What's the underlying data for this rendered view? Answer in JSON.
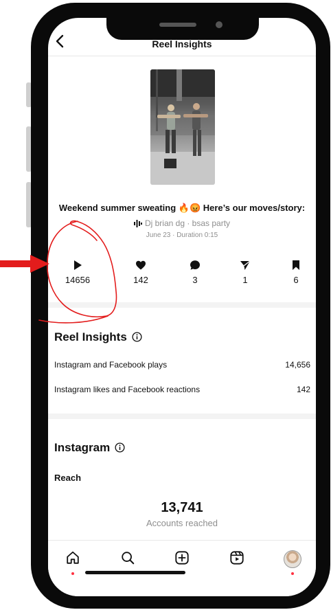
{
  "header": {
    "title": "Reel Insights"
  },
  "post": {
    "caption": "Weekend summer sweating 🔥😡 Here’s our moves/story:",
    "audio": "Dj brian dg · bsas party",
    "meta": "June 23 · Duration 0:15"
  },
  "stats": [
    {
      "icon": "play-icon",
      "value": "14656"
    },
    {
      "icon": "heart-icon",
      "value": "142"
    },
    {
      "icon": "comment-icon",
      "value": "3"
    },
    {
      "icon": "share-icon",
      "value": "1"
    },
    {
      "icon": "bookmark-icon",
      "value": "6"
    }
  ],
  "reel_insights": {
    "title": "Reel Insights",
    "rows": [
      {
        "label": "Instagram and Facebook plays",
        "value": "14,656"
      },
      {
        "label": "Instagram likes and Facebook reactions",
        "value": "142"
      }
    ]
  },
  "instagram": {
    "title": "Instagram",
    "reach_title": "Reach",
    "reach_value": "13,741",
    "reach_label": "Accounts reached"
  },
  "nav": {
    "items": [
      "home-icon",
      "search-icon",
      "create-icon",
      "reels-icon",
      "profile-avatar"
    ],
    "active_dot_color": "#ff3040"
  },
  "colors": {
    "annotation": "#e31c1c",
    "secondary_text": "#8e8e8e",
    "frame": "#0a0a0a"
  }
}
